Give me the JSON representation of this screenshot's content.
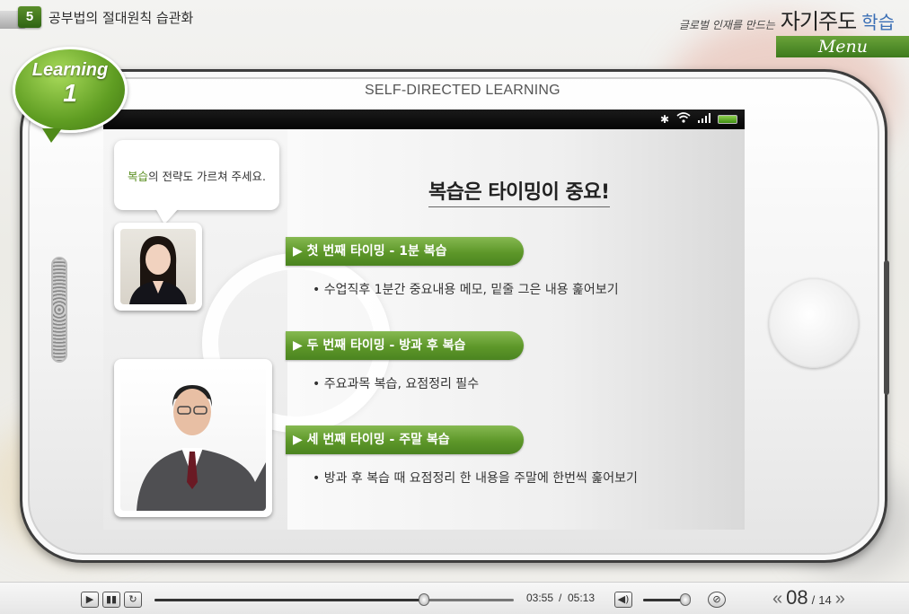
{
  "header": {
    "chapter_number": "5",
    "chapter_title": "공부법의 절대원칙 습관화",
    "brand_sub": "글로벌 인재를 만드는",
    "brand_main": "자기주도",
    "brand_accent": "학습",
    "menu_label": "Menu"
  },
  "badge": {
    "word": "Learning",
    "number": "1"
  },
  "phone": {
    "title": "SELF-DIRECTED LEARNING"
  },
  "dialog": {
    "highlight": "복습",
    "rest": "의 전략도 가르쳐 주세요."
  },
  "slide": {
    "title": "복습은 타이밍이 중요!",
    "items": [
      {
        "heading": "▶ 첫 번째 타이밍 - 1분 복습",
        "detail": "• 수업직후 1분간 중요내용 메모, 밑줄 그은 내용 훑어보기"
      },
      {
        "heading": "▶ 두 번째 타이밍 - 방과 후 복습",
        "detail": "• 주요과목 복습, 요점정리 필수"
      },
      {
        "heading": "▶ 세 번째 타이밍 - 주말 복습",
        "detail": "• 방과 후 복습 때 요점정리 한 내용을 주말에 한번씩 훑어보기"
      }
    ]
  },
  "player": {
    "current_time": "03:55",
    "separator": "/",
    "total_time": "05:13",
    "progress_fraction": 0.75,
    "volume_fraction": 0.9,
    "page_current": "08",
    "page_total": "14",
    "page_separator": "/"
  },
  "colors": {
    "accent_green": "#5d9729",
    "brand_blue": "#3b6fb5"
  }
}
